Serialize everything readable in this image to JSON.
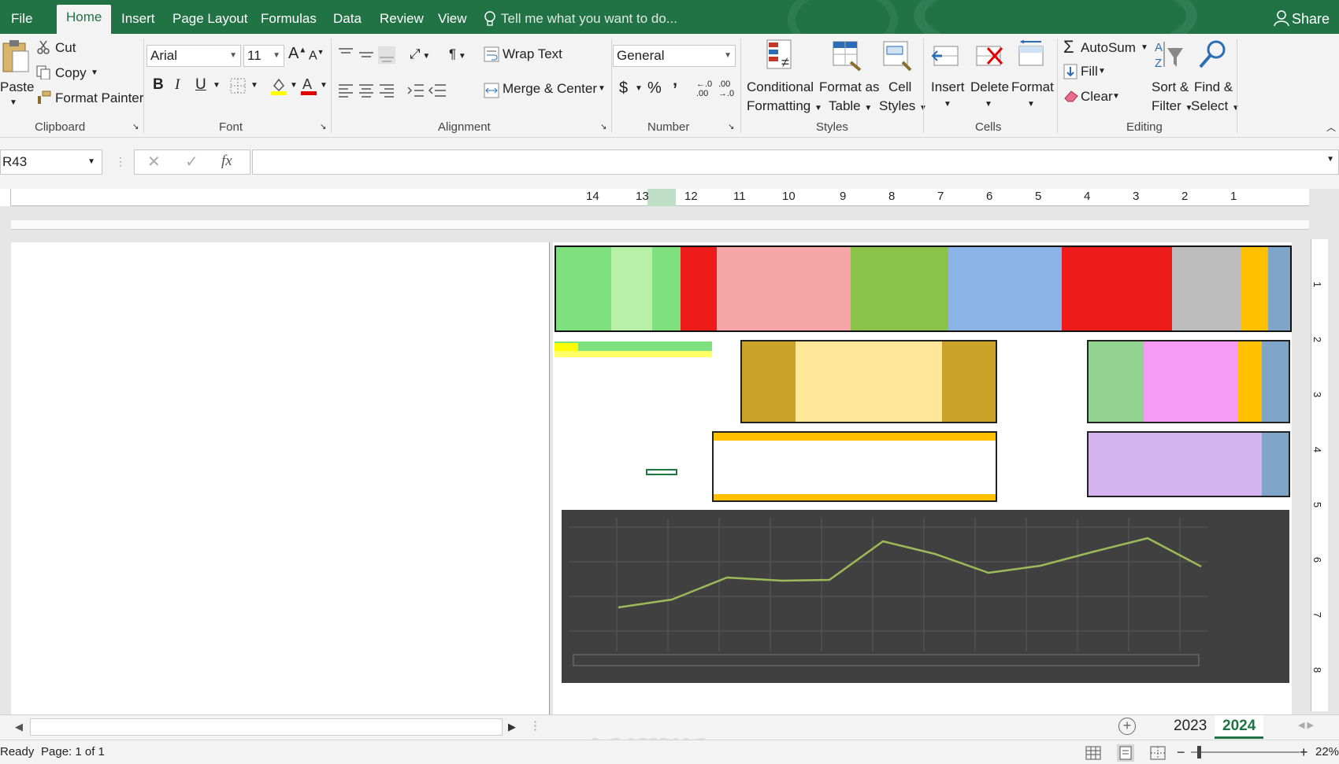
{
  "tabs": [
    "File",
    "Home",
    "Insert",
    "Page Layout",
    "Formulas",
    "Data",
    "Review",
    "View"
  ],
  "tell_me": "Tell me what you want to do...",
  "share": "Share",
  "clipboard": {
    "paste": "Paste",
    "cut": "Cut",
    "copy": "Copy",
    "format_painter": "Format Painter",
    "label": "Clipboard"
  },
  "font": {
    "name": "Arial",
    "size": "11",
    "bold": "B",
    "italic": "I",
    "underline": "U",
    "label": "Font"
  },
  "alignment": {
    "wrap_text": "Wrap Text",
    "merge_center": "Merge & Center",
    "label": "Alignment"
  },
  "number": {
    "format": "General",
    "currency": "$",
    "percent": "%",
    "comma": "’",
    "inc_dec": ".0 .00",
    "dec_dec": ".00 .0",
    "label": "Number"
  },
  "styles": {
    "conditional": "Conditional",
    "formatting": "Formatting",
    "format_as": "Format as",
    "table": "Table",
    "cell": "Cell",
    "cell_styles": "Styles",
    "label": "Styles"
  },
  "cells": {
    "insert": "Insert",
    "delete": "Delete",
    "format": "Format",
    "label": "Cells"
  },
  "editing": {
    "autosum": "AutoSum",
    "fill": "Fill",
    "clear": "Clear",
    "sort_filter": "Sort &",
    "filter": "Filter",
    "find_select": "Find &",
    "select": "Select",
    "label": "Editing"
  },
  "formula_bar": {
    "name_box": "R43",
    "fx": "fx",
    "value": ""
  },
  "ruler_numbers": [
    "14",
    "13",
    "12",
    "11",
    "10",
    "9",
    "8",
    "7",
    "6",
    "5",
    "4",
    "3",
    "2",
    "1"
  ],
  "vruler_numbers": [
    "1",
    "2",
    "3",
    "4",
    "5",
    "6",
    "7",
    "8"
  ],
  "sheets": [
    "2023",
    "2024"
  ],
  "active_sheet": "2024",
  "status": {
    "ready": "Ready",
    "page": "Page: 1 of 1",
    "zoom": "22%"
  },
  "colors": {
    "accent": "#217346"
  }
}
